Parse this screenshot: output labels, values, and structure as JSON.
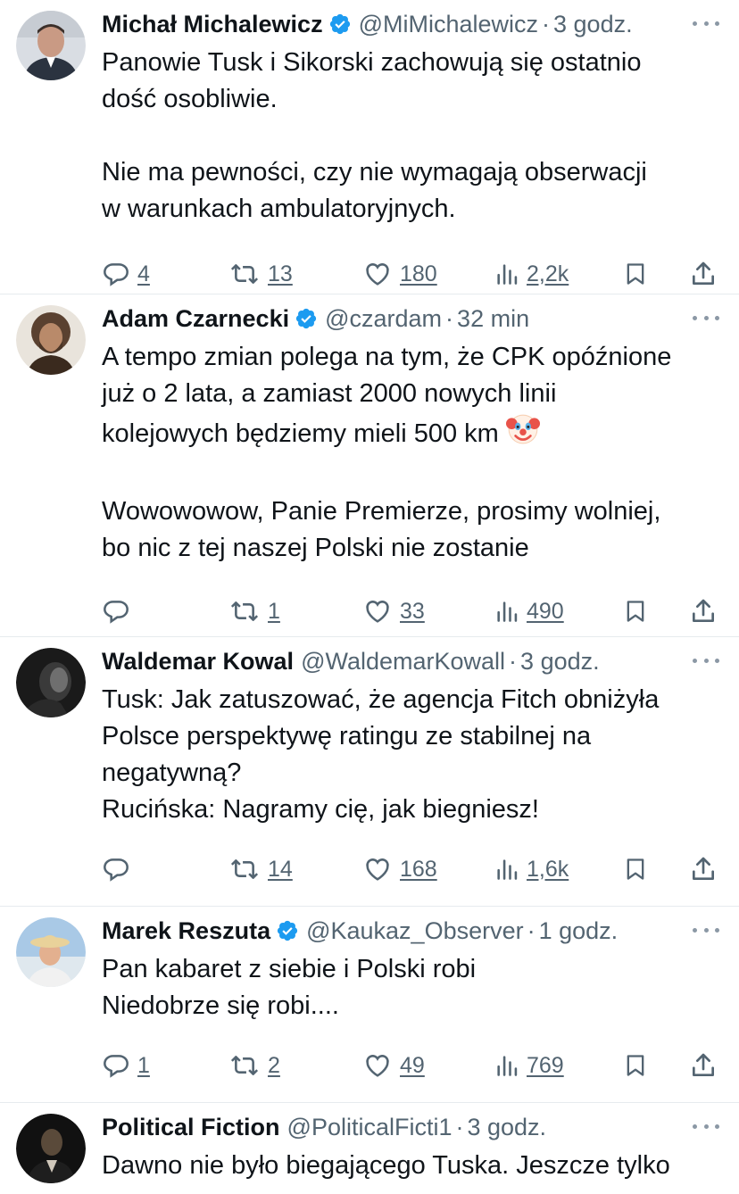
{
  "tweets": [
    {
      "name": "Michał Michalewicz",
      "verified": true,
      "handle": "@MiMichalewicz",
      "time": "3 godz.",
      "text": "Panowie Tusk i Sikorski zachowują się ostatnio\ndość osobliwie.\n\nNie ma pewności, czy nie wymagają obserwacji\nw warunkach ambulatoryjnych.",
      "replies": "4",
      "retweets": "13",
      "likes": "180",
      "views": "2,2k",
      "avatar_colors": [
        "#d9dde3",
        "#2b3340",
        "#c99a84"
      ]
    },
    {
      "name": "Adam Czarnecki",
      "verified": true,
      "handle": "@czardam",
      "time": "32 min",
      "text": "A tempo zmian polega na tym, że CPK opóźnione\njuż o 2 lata, a zamiast 2000 nowych linii\nkolejowych będziemy mieli 500 km ",
      "text_after_emoji": "\n\nWowowowow, Panie Premierze, prosimy wolniej,\nbo nic z tej naszej Polski nie zostanie",
      "emoji": "clown-face",
      "replies": "",
      "retweets": "1",
      "likes": "33",
      "views": "490",
      "avatar_colors": [
        "#e9e4dc",
        "#3a2a1e",
        "#b98a6a"
      ]
    },
    {
      "name": "Waldemar Kowal",
      "verified": false,
      "handle": "@WaldemarKowall",
      "time": "3 godz.",
      "text": "Tusk: Jak zatuszować, że agencja Fitch obniżyła\nPolsce perspektywę ratingu ze stabilnej na\nnegatywną?\nRucińska: Nagramy cię, jak biegniesz!",
      "replies": "",
      "retweets": "14",
      "likes": "168",
      "views": "1,6k",
      "avatar_colors": [
        "#1a1a1a",
        "#6f6f6f",
        "#3a3a3a"
      ]
    },
    {
      "name": "Marek Reszuta",
      "verified": true,
      "handle": "@Kaukaz_Observer",
      "time": "1 godz.",
      "text": "Pan kabaret z siebie i Polski robi\nNiedobrze się robi....",
      "replies": "1",
      "retweets": "2",
      "likes": "49",
      "views": "769",
      "avatar_colors": [
        "#a9c9e6",
        "#e9d29a",
        "#f1f1f1"
      ]
    },
    {
      "name": "Political Fiction",
      "verified": false,
      "handle": "@PoliticalFicti1",
      "time": "3 godz.",
      "text": "Dawno nie było biegającego Tuska. Jeszcze tylko",
      "avatar_colors": [
        "#111111",
        "#5a4a3a",
        "#d0c8bb"
      ]
    }
  ],
  "colors": {
    "verified": "#1d9bf0",
    "muted": "#536471",
    "text": "#0f1419",
    "divider": "#e6ebee"
  },
  "icons": {
    "reply": "reply-bubble-icon",
    "retweet": "retweet-icon",
    "like": "heart-icon",
    "views": "views-bar-chart-icon",
    "bookmark": "bookmark-icon",
    "share": "share-upload-icon",
    "more": "more-dots-icon",
    "verified": "verified-badge-icon"
  }
}
